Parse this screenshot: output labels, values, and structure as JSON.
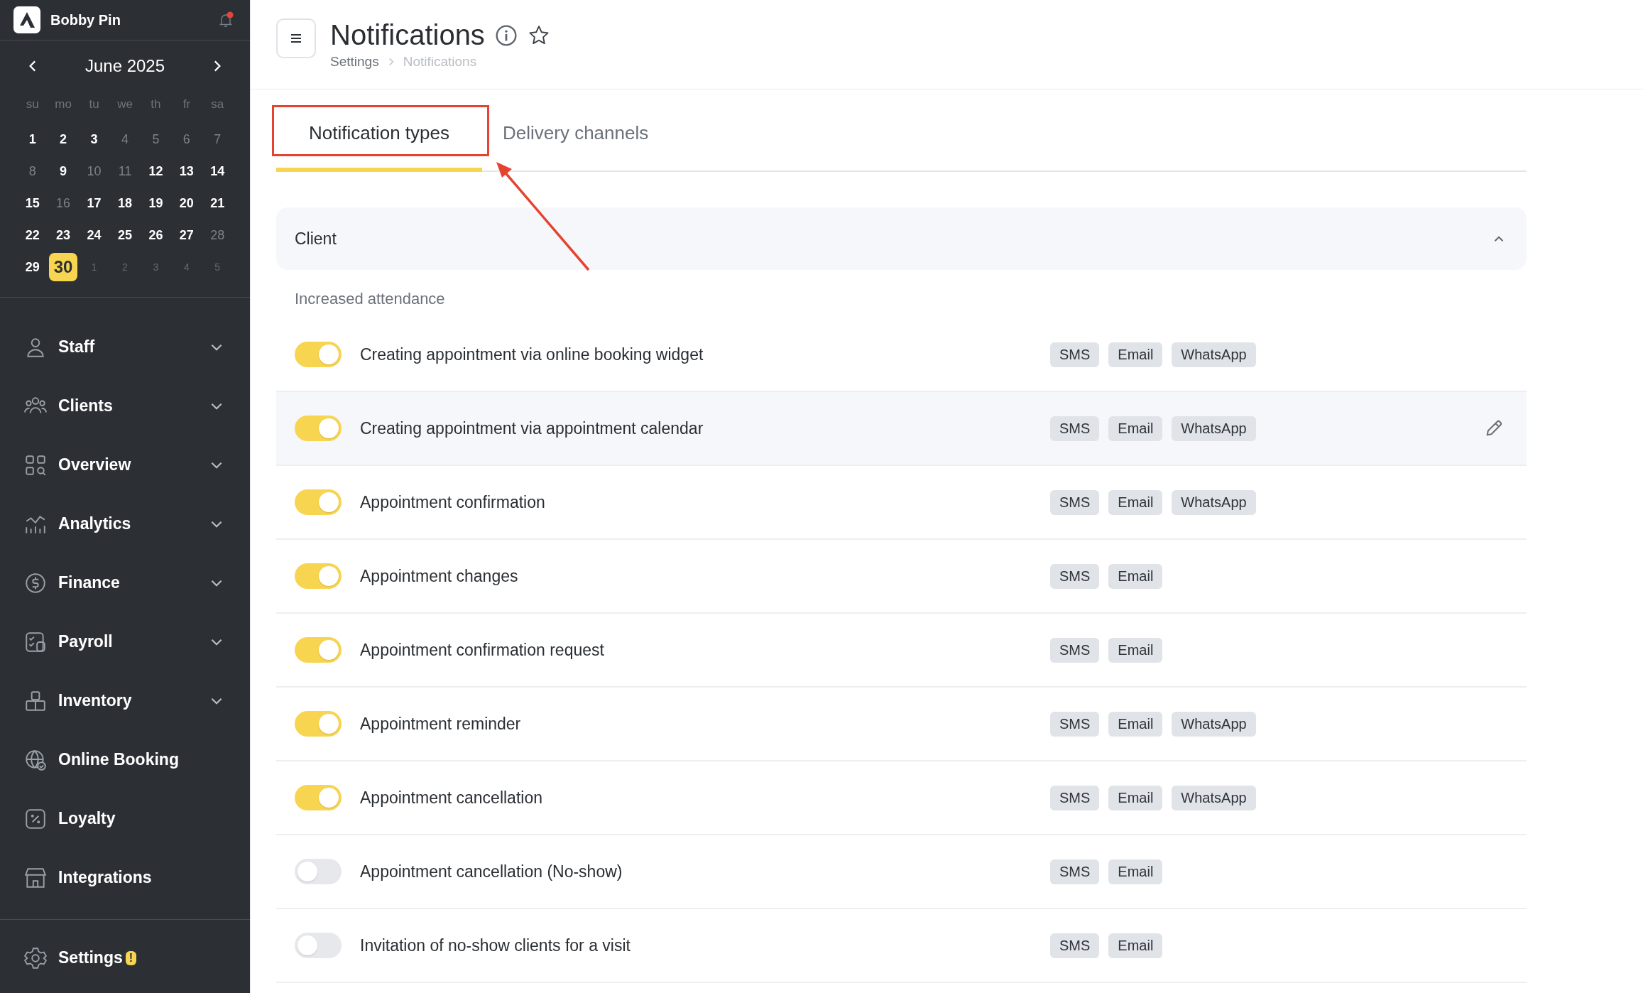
{
  "sidebar": {
    "user": "Bobby Pin",
    "has_notification": true,
    "calendar": {
      "month": "June 2025",
      "weekdays": [
        "su",
        "mo",
        "tu",
        "we",
        "th",
        "fr",
        "sa"
      ],
      "days": [
        {
          "label": "1",
          "kind": "day",
          "muted": false,
          "selected": false
        },
        {
          "label": "2",
          "kind": "day",
          "muted": false,
          "selected": false
        },
        {
          "label": "3",
          "kind": "day",
          "muted": false,
          "selected": false
        },
        {
          "label": "4",
          "kind": "day",
          "muted": true,
          "selected": false
        },
        {
          "label": "5",
          "kind": "day",
          "muted": true,
          "selected": false
        },
        {
          "label": "6",
          "kind": "day",
          "muted": true,
          "selected": false
        },
        {
          "label": "7",
          "kind": "day",
          "muted": true,
          "selected": false
        },
        {
          "label": "8",
          "kind": "day",
          "muted": true,
          "selected": false
        },
        {
          "label": "9",
          "kind": "day",
          "muted": false,
          "selected": false
        },
        {
          "label": "10",
          "kind": "day",
          "muted": true,
          "selected": false
        },
        {
          "label": "11",
          "kind": "day",
          "muted": true,
          "selected": false
        },
        {
          "label": "12",
          "kind": "day",
          "muted": false,
          "selected": false
        },
        {
          "label": "13",
          "kind": "day",
          "muted": false,
          "selected": false
        },
        {
          "label": "14",
          "kind": "day",
          "muted": false,
          "selected": false
        },
        {
          "label": "15",
          "kind": "day",
          "muted": false,
          "selected": false
        },
        {
          "label": "16",
          "kind": "day",
          "muted": true,
          "selected": false
        },
        {
          "label": "17",
          "kind": "day",
          "muted": false,
          "selected": false
        },
        {
          "label": "18",
          "kind": "day",
          "muted": false,
          "selected": false
        },
        {
          "label": "19",
          "kind": "day",
          "muted": false,
          "selected": false
        },
        {
          "label": "20",
          "kind": "day",
          "muted": false,
          "selected": false
        },
        {
          "label": "21",
          "kind": "day",
          "muted": false,
          "selected": false
        },
        {
          "label": "22",
          "kind": "day",
          "muted": false,
          "selected": false
        },
        {
          "label": "23",
          "kind": "day",
          "muted": false,
          "selected": false
        },
        {
          "label": "24",
          "kind": "day",
          "muted": false,
          "selected": false
        },
        {
          "label": "25",
          "kind": "day",
          "muted": false,
          "selected": false
        },
        {
          "label": "26",
          "kind": "day",
          "muted": false,
          "selected": false
        },
        {
          "label": "27",
          "kind": "day",
          "muted": false,
          "selected": false
        },
        {
          "label": "28",
          "kind": "day",
          "muted": true,
          "selected": false
        },
        {
          "label": "29",
          "kind": "day",
          "muted": false,
          "selected": false
        },
        {
          "label": "30",
          "kind": "day",
          "muted": false,
          "selected": true
        },
        {
          "label": "1",
          "kind": "outside",
          "muted": true,
          "selected": false
        },
        {
          "label": "2",
          "kind": "outside",
          "muted": true,
          "selected": false
        },
        {
          "label": "3",
          "kind": "outside",
          "muted": true,
          "selected": false
        },
        {
          "label": "4",
          "kind": "outside",
          "muted": true,
          "selected": false
        },
        {
          "label": "5",
          "kind": "outside",
          "muted": true,
          "selected": false
        }
      ]
    },
    "items": [
      {
        "label": "Staff",
        "kind": "staff",
        "expandable": true
      },
      {
        "label": "Clients",
        "kind": "clients",
        "expandable": true
      },
      {
        "label": "Overview",
        "kind": "overview",
        "expandable": true
      },
      {
        "label": "Analytics",
        "kind": "analytics",
        "expandable": true
      },
      {
        "label": "Finance",
        "kind": "finance",
        "expandable": true
      },
      {
        "label": "Payroll",
        "kind": "payroll",
        "expandable": true
      },
      {
        "label": "Inventory",
        "kind": "inventory",
        "expandable": true
      },
      {
        "label": "Online Booking",
        "kind": "booking",
        "expandable": false
      },
      {
        "label": "Loyalty",
        "kind": "loyalty",
        "expandable": false
      },
      {
        "label": "Integrations",
        "kind": "integrations",
        "expandable": false
      }
    ],
    "settings": {
      "label": "Settings",
      "badge": "!"
    }
  },
  "header": {
    "title": "Notifications",
    "breadcrumb": [
      "Settings",
      "Notifications"
    ]
  },
  "tabs": [
    {
      "label": "Notification types",
      "selected": true
    },
    {
      "label": "Delivery channels",
      "selected": false
    }
  ],
  "section": {
    "title": "Client",
    "expanded": true,
    "group": "Increased attendance",
    "rows": [
      {
        "label": "Creating appointment via online booking widget",
        "on": true,
        "highlighted": false,
        "channels": [
          "SMS",
          "Email",
          "WhatsApp"
        ]
      },
      {
        "label": "Creating appointment via appointment calendar",
        "on": true,
        "highlighted": true,
        "channels": [
          "SMS",
          "Email",
          "WhatsApp"
        ]
      },
      {
        "label": "Appointment confirmation",
        "on": true,
        "highlighted": false,
        "channels": [
          "SMS",
          "Email",
          "WhatsApp"
        ]
      },
      {
        "label": "Appointment changes",
        "on": true,
        "highlighted": false,
        "channels": [
          "SMS",
          "Email"
        ]
      },
      {
        "label": "Appointment confirmation request",
        "on": true,
        "highlighted": false,
        "channels": [
          "SMS",
          "Email"
        ]
      },
      {
        "label": "Appointment reminder",
        "on": true,
        "highlighted": false,
        "channels": [
          "SMS",
          "Email",
          "WhatsApp"
        ]
      },
      {
        "label": "Appointment cancellation",
        "on": true,
        "highlighted": false,
        "channels": [
          "SMS",
          "Email",
          "WhatsApp"
        ]
      },
      {
        "label": "Appointment cancellation (No-show)",
        "on": false,
        "highlighted": false,
        "channels": [
          "SMS",
          "Email"
        ]
      },
      {
        "label": "Invitation of no-show clients for a visit",
        "on": false,
        "highlighted": false,
        "channels": [
          "SMS",
          "Email"
        ]
      }
    ]
  }
}
